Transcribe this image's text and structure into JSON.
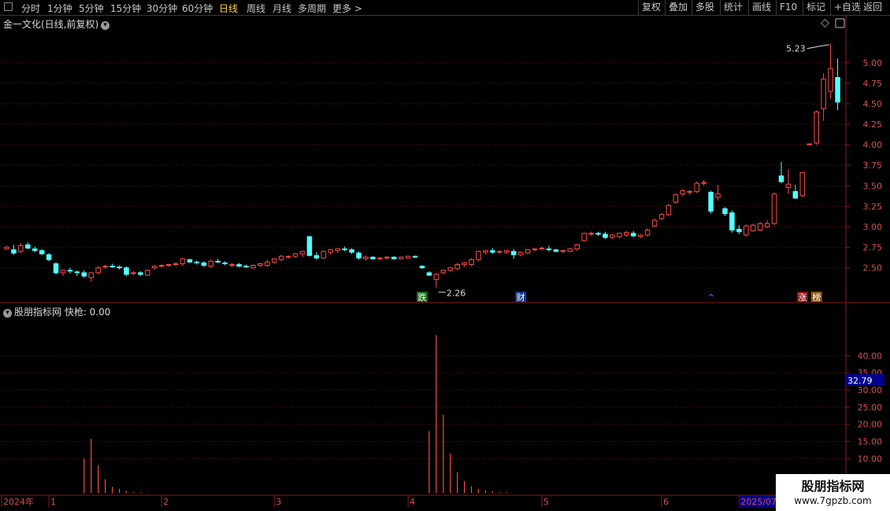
{
  "toolbar": {
    "periods": [
      "分时",
      "1分钟",
      "5分钟",
      "15分钟",
      "30分钟",
      "60分钟",
      "日线",
      "周线",
      "月线",
      "多周期",
      "更多 >"
    ],
    "active_period": "日线",
    "right_buttons": [
      "复权",
      "叠加",
      "多股",
      "统计",
      "画线",
      "F10",
      "标记",
      "+自选",
      "返回"
    ]
  },
  "main_title": "金一文化(日线,前复权)",
  "indicator_title": "股朋指标网 快枪: 0.00",
  "current_value_badge": "32.79",
  "watermark": {
    "line1": "股朋指标网",
    "line2": "www.7gpzb.com"
  },
  "colors": {
    "up": "#ff4a4a",
    "down": "#54ffff",
    "grid": "#6a1515",
    "axis": "#8b1a1a",
    "badge": "#00008f"
  },
  "chart_data": [
    {
      "type": "candlestick",
      "ylim": [
        2.2,
        5.4
      ],
      "yticks": [
        "2.50",
        "2.75",
        "3.00",
        "3.25",
        "3.50",
        "3.75",
        "4.00",
        "4.25",
        "4.50",
        "4.75",
        "5.00"
      ],
      "ohlc": [
        [
          2.73,
          2.77,
          2.72,
          2.75
        ],
        [
          2.72,
          2.78,
          2.66,
          2.68
        ],
        [
          2.7,
          2.8,
          2.68,
          2.77
        ],
        [
          2.78,
          2.81,
          2.73,
          2.74
        ],
        [
          2.73,
          2.76,
          2.69,
          2.71
        ],
        [
          2.71,
          2.73,
          2.66,
          2.67
        ],
        [
          2.66,
          2.68,
          2.58,
          2.6
        ],
        [
          2.55,
          2.57,
          2.42,
          2.44
        ],
        [
          2.44,
          2.48,
          2.4,
          2.47
        ],
        [
          2.47,
          2.5,
          2.43,
          2.46
        ],
        [
          2.45,
          2.47,
          2.4,
          2.44
        ],
        [
          2.44,
          2.47,
          2.38,
          2.4
        ],
        [
          2.38,
          2.45,
          2.33,
          2.44
        ],
        [
          2.44,
          2.52,
          2.42,
          2.5
        ],
        [
          2.51,
          2.54,
          2.49,
          2.52
        ],
        [
          2.52,
          2.55,
          2.5,
          2.51
        ],
        [
          2.51,
          2.53,
          2.48,
          2.5
        ],
        [
          2.5,
          2.52,
          2.4,
          2.42
        ],
        [
          2.43,
          2.46,
          2.41,
          2.44
        ],
        [
          2.44,
          2.46,
          2.4,
          2.42
        ],
        [
          2.41,
          2.48,
          2.4,
          2.47
        ],
        [
          2.5,
          2.53,
          2.48,
          2.52
        ],
        [
          2.52,
          2.54,
          2.5,
          2.53
        ],
        [
          2.53,
          2.55,
          2.51,
          2.54
        ],
        [
          2.54,
          2.57,
          2.52,
          2.55
        ],
        [
          2.55,
          2.62,
          2.52,
          2.61
        ],
        [
          2.6,
          2.61,
          2.56,
          2.57
        ],
        [
          2.57,
          2.59,
          2.54,
          2.56
        ],
        [
          2.56,
          2.58,
          2.51,
          2.53
        ],
        [
          2.52,
          2.6,
          2.5,
          2.58
        ],
        [
          2.58,
          2.61,
          2.56,
          2.57
        ],
        [
          2.56,
          2.58,
          2.53,
          2.55
        ],
        [
          2.53,
          2.56,
          2.51,
          2.54
        ],
        [
          2.54,
          2.56,
          2.51,
          2.52
        ],
        [
          2.52,
          2.54,
          2.5,
          2.51
        ],
        [
          2.5,
          2.54,
          2.49,
          2.53
        ],
        [
          2.53,
          2.56,
          2.51,
          2.55
        ],
        [
          2.53,
          2.6,
          2.51,
          2.57
        ],
        [
          2.57,
          2.62,
          2.55,
          2.61
        ],
        [
          2.6,
          2.66,
          2.58,
          2.64
        ],
        [
          2.63,
          2.65,
          2.61,
          2.64
        ],
        [
          2.64,
          2.68,
          2.62,
          2.67
        ],
        [
          2.67,
          2.71,
          2.63,
          2.7
        ],
        [
          2.88,
          2.89,
          2.64,
          2.65
        ],
        [
          2.65,
          2.69,
          2.6,
          2.62
        ],
        [
          2.62,
          2.71,
          2.61,
          2.7
        ],
        [
          2.69,
          2.73,
          2.66,
          2.72
        ],
        [
          2.71,
          2.74,
          2.68,
          2.73
        ],
        [
          2.73,
          2.76,
          2.7,
          2.72
        ],
        [
          2.72,
          2.74,
          2.67,
          2.69
        ],
        [
          2.68,
          2.7,
          2.6,
          2.62
        ],
        [
          2.61,
          2.65,
          2.59,
          2.63
        ],
        [
          2.63,
          2.64,
          2.6,
          2.61
        ],
        [
          2.61,
          2.63,
          2.59,
          2.62
        ],
        [
          2.62,
          2.64,
          2.6,
          2.63
        ],
        [
          2.63,
          2.64,
          2.6,
          2.61
        ],
        [
          2.61,
          2.64,
          2.6,
          2.63
        ],
        [
          2.62,
          2.65,
          2.61,
          2.64
        ],
        [
          2.64,
          2.65,
          2.62,
          2.63
        ],
        [
          2.52,
          2.53,
          2.49,
          2.5
        ],
        [
          2.44,
          2.46,
          2.4,
          2.41
        ],
        [
          2.36,
          2.44,
          2.26,
          2.42
        ],
        [
          2.44,
          2.48,
          2.42,
          2.47
        ],
        [
          2.47,
          2.51,
          2.45,
          2.5
        ],
        [
          2.49,
          2.56,
          2.47,
          2.54
        ],
        [
          2.54,
          2.57,
          2.51,
          2.56
        ],
        [
          2.54,
          2.62,
          2.52,
          2.6
        ],
        [
          2.6,
          2.71,
          2.58,
          2.7
        ],
        [
          2.69,
          2.72,
          2.66,
          2.71
        ],
        [
          2.71,
          2.74,
          2.67,
          2.69
        ],
        [
          2.69,
          2.71,
          2.67,
          2.7
        ],
        [
          2.69,
          2.72,
          2.67,
          2.71
        ],
        [
          2.7,
          2.73,
          2.61,
          2.66
        ],
        [
          2.66,
          2.7,
          2.64,
          2.69
        ],
        [
          2.68,
          2.73,
          2.67,
          2.72
        ],
        [
          2.72,
          2.74,
          2.7,
          2.73
        ],
        [
          2.73,
          2.76,
          2.71,
          2.74
        ],
        [
          2.73,
          2.77,
          2.7,
          2.72
        ],
        [
          2.72,
          2.73,
          2.69,
          2.7
        ],
        [
          2.7,
          2.72,
          2.68,
          2.71
        ],
        [
          2.7,
          2.74,
          2.69,
          2.73
        ],
        [
          2.73,
          2.79,
          2.71,
          2.78
        ],
        [
          2.83,
          2.93,
          2.82,
          2.92
        ],
        [
          2.91,
          2.94,
          2.89,
          2.92
        ],
        [
          2.92,
          2.94,
          2.89,
          2.91
        ],
        [
          2.91,
          2.94,
          2.85,
          2.87
        ],
        [
          2.87,
          2.91,
          2.85,
          2.9
        ],
        [
          2.88,
          2.93,
          2.86,
          2.92
        ],
        [
          2.9,
          2.95,
          2.88,
          2.93
        ],
        [
          2.92,
          2.95,
          2.87,
          2.89
        ],
        [
          2.88,
          2.91,
          2.86,
          2.9
        ],
        [
          2.9,
          2.98,
          2.88,
          2.96
        ],
        [
          3.01,
          3.1,
          3.0,
          3.08
        ],
        [
          3.1,
          3.17,
          3.08,
          3.15
        ],
        [
          3.15,
          3.28,
          3.13,
          3.26
        ],
        [
          3.3,
          3.41,
          3.28,
          3.39
        ],
        [
          3.4,
          3.46,
          3.37,
          3.44
        ],
        [
          3.42,
          3.45,
          3.39,
          3.43
        ],
        [
          3.43,
          3.55,
          3.41,
          3.53
        ],
        [
          3.54,
          3.57,
          3.5,
          3.54
        ],
        [
          3.42,
          3.44,
          3.16,
          3.19
        ],
        [
          3.36,
          3.51,
          3.32,
          3.4
        ],
        [
          3.22,
          3.24,
          3.13,
          3.16
        ],
        [
          3.17,
          3.2,
          2.93,
          2.96
        ],
        [
          2.97,
          3.02,
          2.91,
          2.94
        ],
        [
          2.9,
          3.03,
          2.88,
          3.01
        ],
        [
          2.95,
          3.04,
          2.94,
          3.02
        ],
        [
          2.96,
          3.06,
          2.95,
          3.04
        ],
        [
          3.0,
          3.08,
          2.98,
          3.04
        ],
        [
          3.04,
          3.42,
          3.02,
          3.4
        ],
        [
          3.62,
          3.79,
          3.53,
          3.55
        ],
        [
          3.48,
          3.7,
          3.4,
          3.52
        ],
        [
          3.43,
          3.51,
          3.34,
          3.35
        ],
        [
          3.38,
          3.67,
          3.36,
          3.66
        ],
        [
          4.0,
          4.01,
          4.0,
          4.01
        ],
        [
          4.02,
          4.42,
          4.0,
          4.4
        ],
        [
          4.44,
          4.87,
          4.29,
          4.8
        ],
        [
          4.65,
          5.23,
          4.56,
          4.93
        ],
        [
          4.82,
          5.05,
          4.42,
          4.52
        ]
      ],
      "annotations": {
        "max_label": "5.23",
        "min_label": "2.26"
      },
      "event_tags": [
        {
          "text": "跌",
          "index": 59
        },
        {
          "text": "财",
          "index": 73
        },
        {
          "text": "^",
          "index": 100
        },
        {
          "text": "涨",
          "index": 113
        },
        {
          "text": "榜",
          "index": 115
        }
      ]
    },
    {
      "type": "bar",
      "title": "股朋指标网 快枪",
      "ylim": [
        0,
        52
      ],
      "yticks": [
        "10.00",
        "15.00",
        "20.00",
        "25.00",
        "30.00",
        "35.00",
        "40.00"
      ],
      "values_by_index": {
        "11": 10,
        "12": 15.8,
        "13": 8.1,
        "14": 4.0,
        "15": 1.8,
        "16": 1.2,
        "17": 0.6,
        "18": 0.3,
        "19": 0.2,
        "20": 0.1,
        "60": 18.0,
        "61": 46.0,
        "62": 22.8,
        "63": 11.5,
        "64": 6.0,
        "65": 3.5,
        "66": 2.0,
        "67": 1.2,
        "68": 0.8,
        "69": 0.5,
        "70": 0.3,
        "71": 0.2
      }
    }
  ],
  "time_axis": [
    {
      "label": "2024年",
      "index": 0
    },
    {
      "label": "1",
      "index": 6
    },
    {
      "label": "2",
      "index": 22
    },
    {
      "label": "3",
      "index": 38
    },
    {
      "label": "4",
      "index": 57
    },
    {
      "label": "5",
      "index": 76
    },
    {
      "label": "6",
      "index": 93
    },
    {
      "label": "2025/07/",
      "index": 104
    }
  ]
}
